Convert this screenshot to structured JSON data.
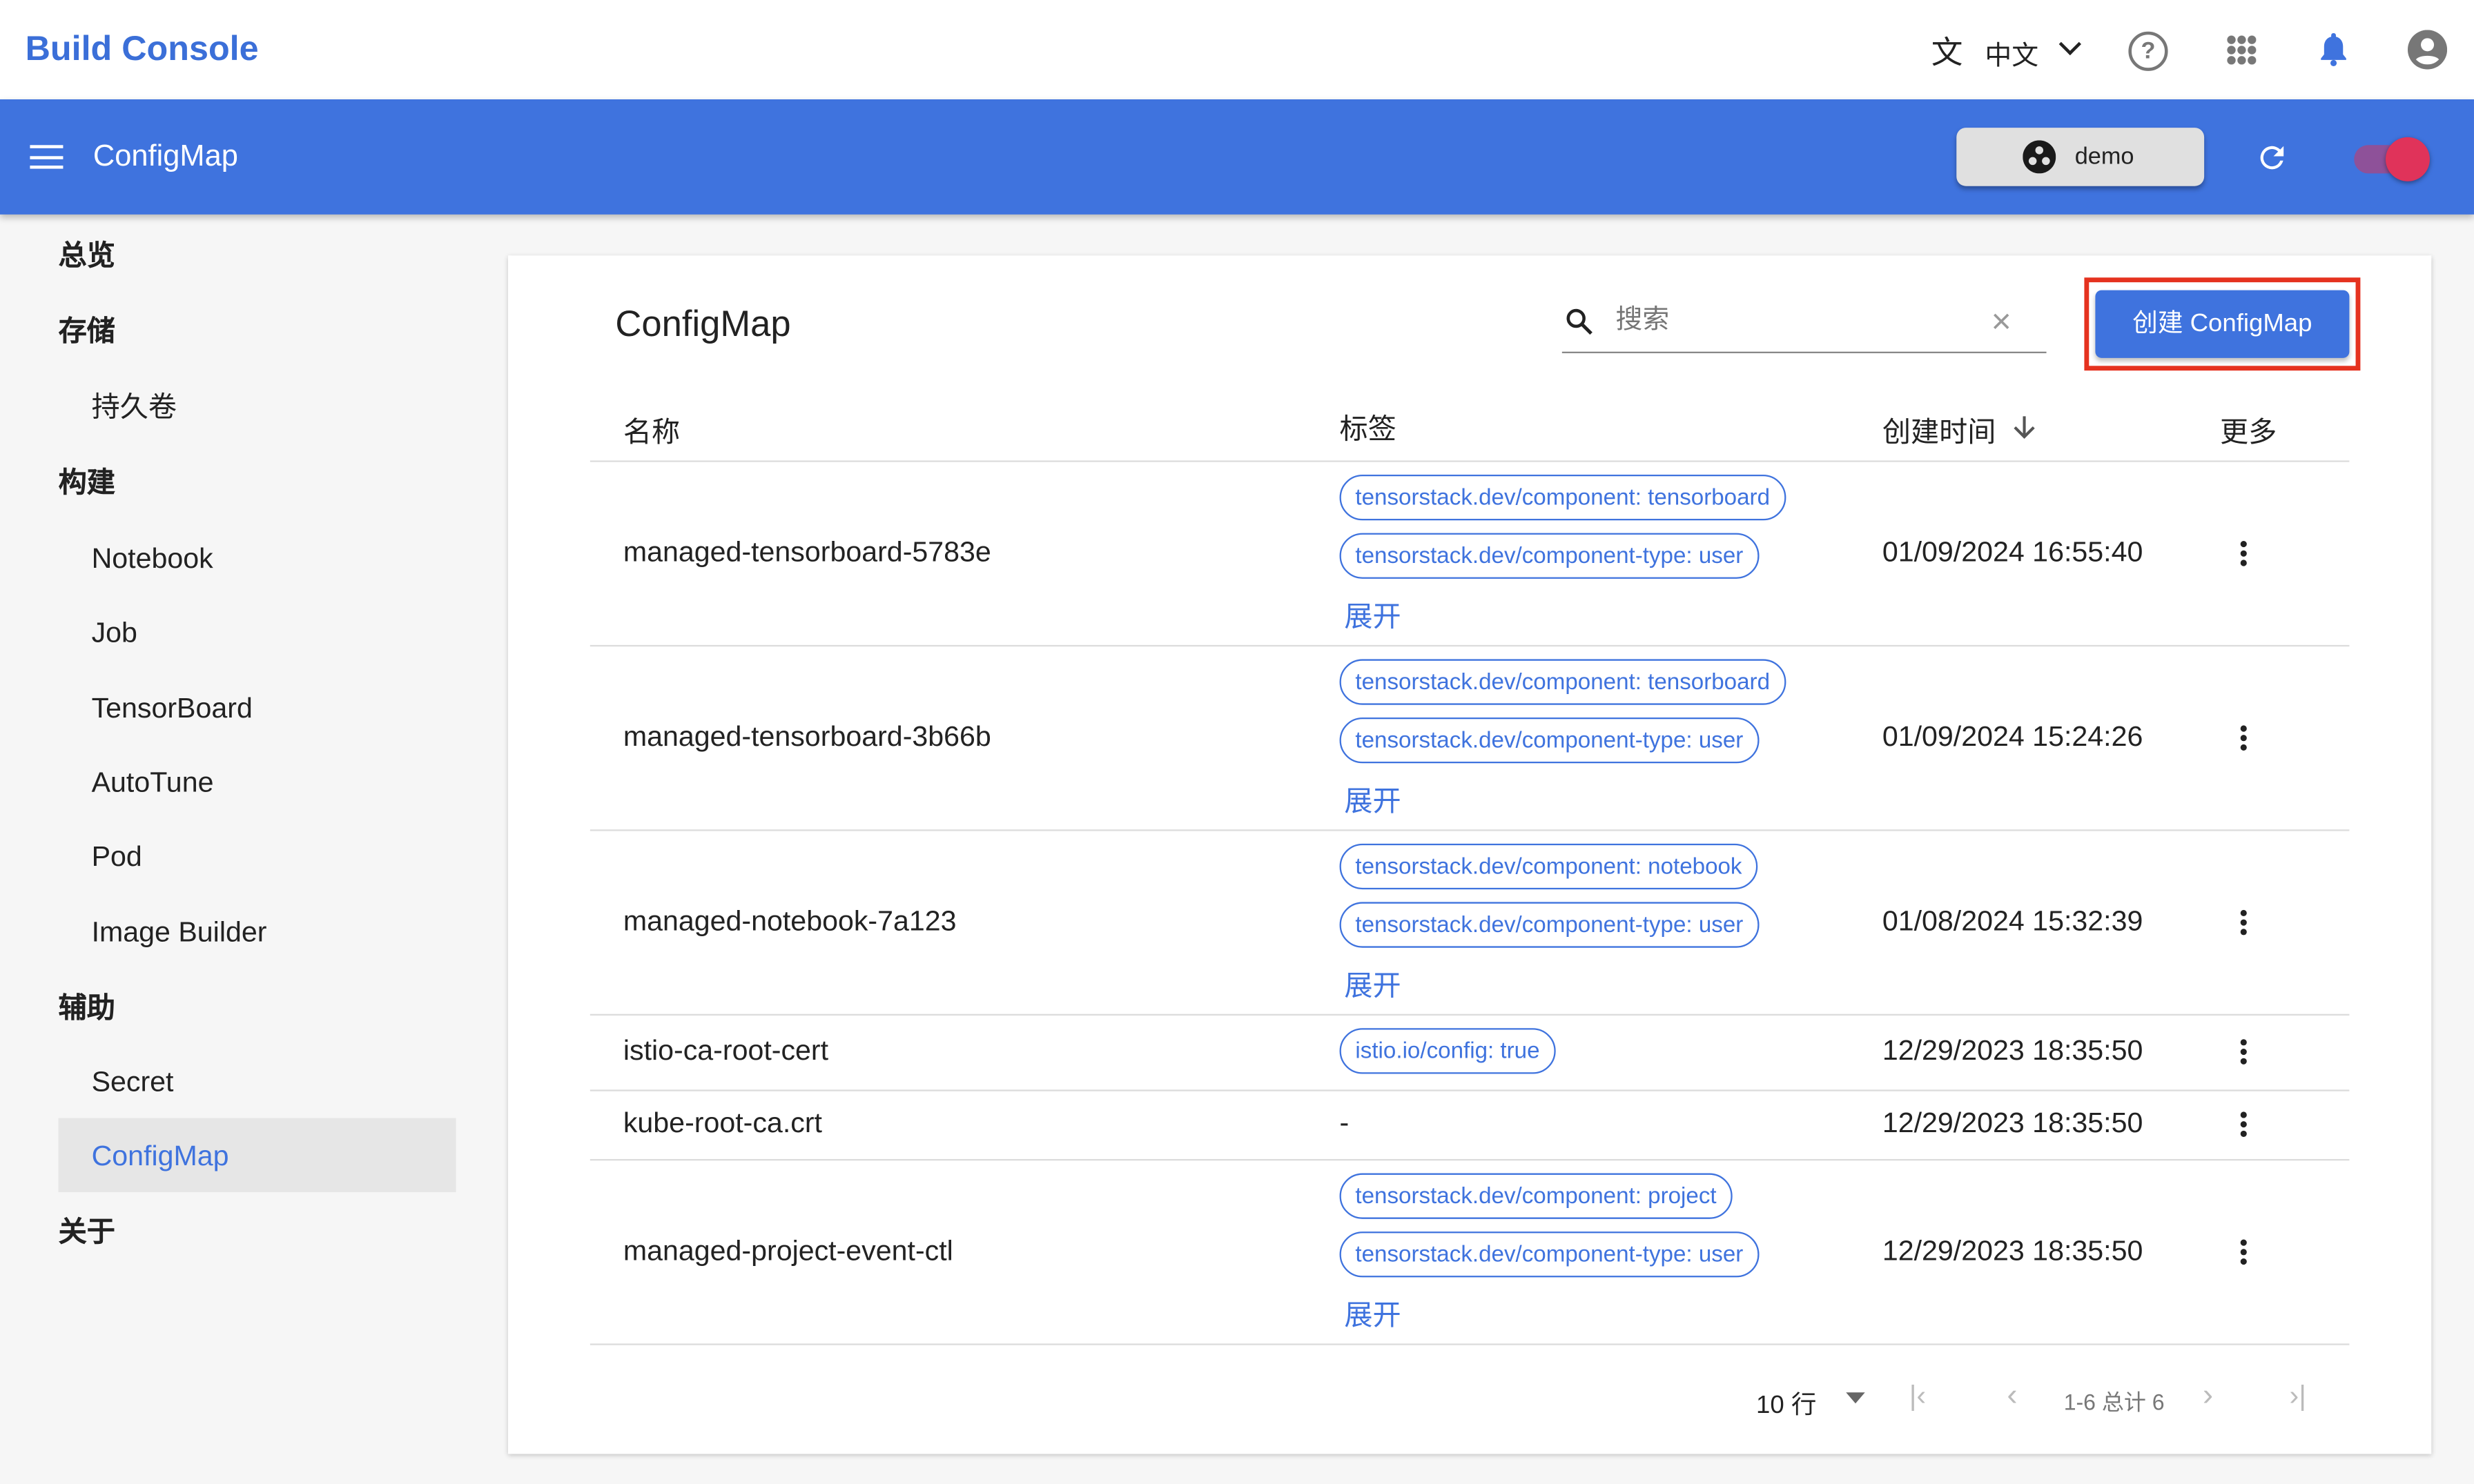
{
  "app": {
    "title": "Build Console",
    "language": "中文",
    "page": "ConfigMap",
    "namespace": "demo",
    "accent": "#3f73de",
    "toggle_color": "#e0335a"
  },
  "sidebar": {
    "items": [
      {
        "label": "总览",
        "level": 0
      },
      {
        "label": "存储",
        "level": 0
      },
      {
        "label": "持久卷",
        "level": 1
      },
      {
        "label": "构建",
        "level": 0
      },
      {
        "label": "Notebook",
        "level": 1
      },
      {
        "label": "Job",
        "level": 1
      },
      {
        "label": "TensorBoard",
        "level": 1
      },
      {
        "label": "AutoTune",
        "level": 1
      },
      {
        "label": "Pod",
        "level": 1
      },
      {
        "label": "Image Builder",
        "level": 1
      },
      {
        "label": "辅助",
        "level": 0
      },
      {
        "label": "Secret",
        "level": 1
      },
      {
        "label": "ConfigMap",
        "level": 1,
        "selected": true
      },
      {
        "label": "关于",
        "level": 0
      }
    ]
  },
  "main": {
    "title": "ConfigMap",
    "search_placeholder": "搜索",
    "create_label": "创建 ConfigMap",
    "columns": {
      "name": "名称",
      "labels": "标签",
      "created": "创建时间",
      "more": "更多"
    },
    "expand_label": "展开",
    "rows": [
      {
        "name": "managed-tensorboard-5783e",
        "labels": [
          "tensorstack.dev/component: tensorboard",
          "tensorstack.dev/component-type: user"
        ],
        "expand": true,
        "created": "01/09/2024 16:55:40"
      },
      {
        "name": "managed-tensorboard-3b66b",
        "labels": [
          "tensorstack.dev/component: tensorboard",
          "tensorstack.dev/component-type: user"
        ],
        "expand": true,
        "created": "01/09/2024 15:24:26"
      },
      {
        "name": "managed-notebook-7a123",
        "labels": [
          "tensorstack.dev/component: notebook",
          "tensorstack.dev/component-type: user"
        ],
        "expand": true,
        "created": "01/08/2024 15:32:39"
      },
      {
        "name": "istio-ca-root-cert",
        "labels": [
          "istio.io/config: true"
        ],
        "expand": false,
        "created": "12/29/2023 18:35:50"
      },
      {
        "name": "kube-root-ca.crt",
        "labels": [],
        "empty": "-",
        "expand": false,
        "created": "12/29/2023 18:35:50"
      },
      {
        "name": "managed-project-event-ctl",
        "labels": [
          "tensorstack.dev/component: project",
          "tensorstack.dev/component-type: user"
        ],
        "expand": true,
        "created": "12/29/2023 18:35:50"
      }
    ],
    "pagination": {
      "rows_per_page": "10 行",
      "range": "1-6 总计 6"
    }
  }
}
